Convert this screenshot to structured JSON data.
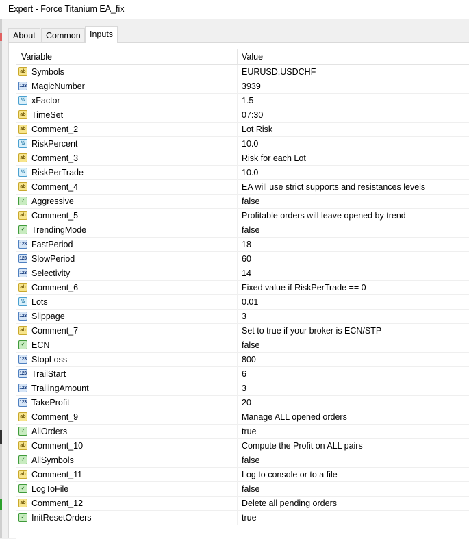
{
  "window": {
    "title": "Expert - Force Titanium EA_fix"
  },
  "tabs": [
    {
      "label": "About",
      "active": false
    },
    {
      "label": "Common",
      "active": false
    },
    {
      "label": "Inputs",
      "active": true
    }
  ],
  "table": {
    "headers": {
      "variable": "Variable",
      "value": "Value"
    },
    "rows": [
      {
        "icon": "string-type-icon",
        "name": "Symbols",
        "value": "EURUSD,USDCHF"
      },
      {
        "icon": "int-type-icon",
        "name": "MagicNumber",
        "value": "3939"
      },
      {
        "icon": "double-type-icon",
        "name": "xFactor",
        "value": "1.5"
      },
      {
        "icon": "string-type-icon",
        "name": "TimeSet",
        "value": "07:30"
      },
      {
        "icon": "string-type-icon",
        "name": "Comment_2",
        "value": "Lot Risk"
      },
      {
        "icon": "double-type-icon",
        "name": "RiskPercent",
        "value": "10.0"
      },
      {
        "icon": "string-type-icon",
        "name": "Comment_3",
        "value": "Risk for each Lot"
      },
      {
        "icon": "double-type-icon",
        "name": "RiskPerTrade",
        "value": "10.0"
      },
      {
        "icon": "string-type-icon",
        "name": "Comment_4",
        "value": "EA will use strict supports and resistances levels"
      },
      {
        "icon": "bool-type-icon",
        "name": "Aggressive",
        "value": "false"
      },
      {
        "icon": "string-type-icon",
        "name": "Comment_5",
        "value": "Profitable orders will leave opened by trend"
      },
      {
        "icon": "bool-type-icon",
        "name": "TrendingMode",
        "value": "false"
      },
      {
        "icon": "int-type-icon",
        "name": "FastPeriod",
        "value": "18"
      },
      {
        "icon": "int-type-icon",
        "name": "SlowPeriod",
        "value": "60"
      },
      {
        "icon": "int-type-icon",
        "name": "Selectivity",
        "value": "14"
      },
      {
        "icon": "string-type-icon",
        "name": "Comment_6",
        "value": "Fixed value if RiskPerTrade == 0"
      },
      {
        "icon": "double-type-icon",
        "name": "Lots",
        "value": "0.01"
      },
      {
        "icon": "int-type-icon",
        "name": "Slippage",
        "value": "3"
      },
      {
        "icon": "string-type-icon",
        "name": "Comment_7",
        "value": "Set to true if your broker is ECN/STP"
      },
      {
        "icon": "bool-type-icon",
        "name": "ECN",
        "value": "false"
      },
      {
        "icon": "int-type-icon",
        "name": "StopLoss",
        "value": "800"
      },
      {
        "icon": "int-type-icon",
        "name": "TrailStart",
        "value": "6"
      },
      {
        "icon": "int-type-icon",
        "name": "TrailingAmount",
        "value": "3"
      },
      {
        "icon": "int-type-icon",
        "name": "TakeProfit",
        "value": "20"
      },
      {
        "icon": "string-type-icon",
        "name": "Comment_9",
        "value": "Manage ALL opened orders"
      },
      {
        "icon": "bool-type-icon",
        "name": "AllOrders",
        "value": "true"
      },
      {
        "icon": "string-type-icon",
        "name": "Comment_10",
        "value": "Compute the Profit on ALL pairs"
      },
      {
        "icon": "bool-type-icon",
        "name": "AllSymbols",
        "value": "false"
      },
      {
        "icon": "string-type-icon",
        "name": "Comment_11",
        "value": "Log to console or to a file"
      },
      {
        "icon": "bool-type-icon",
        "name": "LogToFile",
        "value": "false"
      },
      {
        "icon": "string-type-icon",
        "name": "Comment_12",
        "value": "Delete all pending orders"
      },
      {
        "icon": "bool-type-icon",
        "name": "InitResetOrders",
        "value": "true"
      }
    ]
  },
  "colors": {
    "string_icon": "#f7e58c",
    "int_icon": "#d7e6f7",
    "double_icon": "#d9f0fb",
    "bool_icon": "#c8ecc0"
  }
}
